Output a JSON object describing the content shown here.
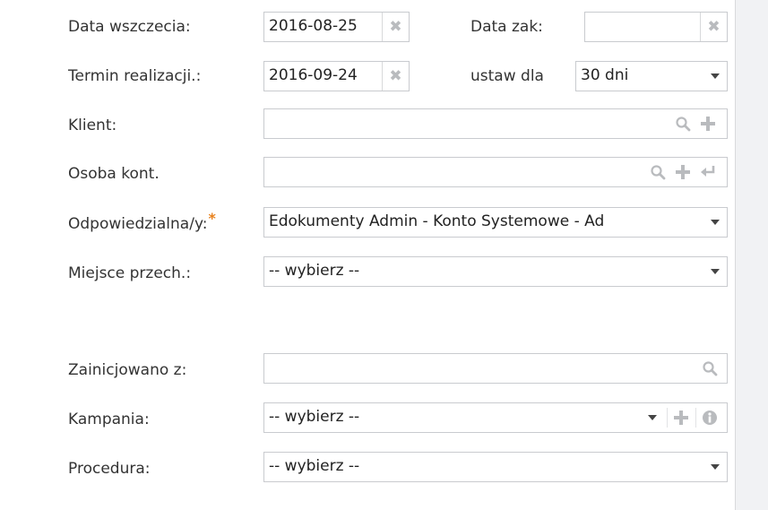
{
  "form": {
    "data_wszczecia": {
      "label": "Data wszczecia:",
      "value": "2016-08-25",
      "clear_icon": "close-icon"
    },
    "data_zak": {
      "label": "Data zak:",
      "value": "",
      "clear_icon": "close-icon"
    },
    "termin_realizacji": {
      "label": "Termin realizacji.:",
      "value": "2016-09-24",
      "clear_icon": "close-icon"
    },
    "ustaw_dla": {
      "label": "ustaw dla",
      "value": "30 dni"
    },
    "klient": {
      "label": "Klient:",
      "value": "",
      "icons": [
        "search-icon",
        "plus-icon"
      ]
    },
    "osoba_kont": {
      "label": "Osoba kont.",
      "value": "",
      "icons": [
        "search-icon",
        "plus-icon",
        "reply-icon"
      ]
    },
    "odpowiedzialna": {
      "label": "Odpowiedzialna/y:",
      "required_mark": "*",
      "value": "Edokumenty Admin - Konto Systemowe - Ad"
    },
    "miejsce_przech": {
      "label": "Miejsce przech.:",
      "value": "-- wybierz --"
    },
    "zainicjowano_z": {
      "label": "Zainicjowano z:",
      "value": "",
      "icons": [
        "search-icon"
      ]
    },
    "kampania": {
      "label": "Kampania:",
      "value": "-- wybierz --",
      "icons": [
        "plus-icon",
        "info-icon"
      ]
    },
    "procedura": {
      "label": "Procedura:",
      "value": "-- wybierz --"
    }
  },
  "colors": {
    "accent_required": "#e8821e",
    "icon_gray": "#b9bbbe",
    "border": "#c9cbcf"
  }
}
